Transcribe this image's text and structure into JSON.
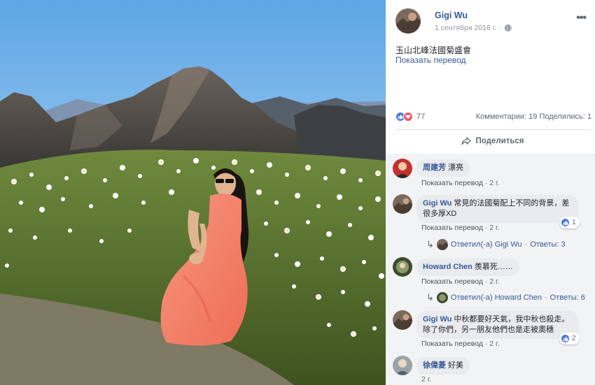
{
  "post": {
    "author": "Gigi Wu",
    "date": "1 сентября 2016 г.",
    "separator": "·",
    "text": "玉山北峰法國菊盛會",
    "translate": "Показать перевод",
    "reaction_count": "77",
    "counts": "Комментарии: 19  Поделились: 1",
    "share_label": "Поделиться",
    "colors": {
      "link": "#365899",
      "like": "#4a78e5",
      "love": "#f0536b"
    }
  },
  "comments": [
    {
      "author": "周建芳",
      "text": "漂亮",
      "translate": "Показать перевод",
      "sep": "·",
      "age": "2 г."
    },
    {
      "author": "Gigi Wu",
      "text": "常見的法國菊配上不同的背景，差",
      "text2": "很多厚XD",
      "translate": "Показать перевод",
      "sep": "·",
      "age": "2 г.",
      "likes": "1",
      "reply": {
        "label": "Ответил(-а) Gigi Wu",
        "sep": "·",
        "count": "Ответы: 3"
      }
    },
    {
      "author": "Howard Chen",
      "text": "羨慕死……",
      "translate": "Показать перевод",
      "sep": "·",
      "age": "2 г.",
      "reply": {
        "label": "Ответил(-а) Howard Chen",
        "sep": "·",
        "count": "Ответы: 6"
      }
    },
    {
      "author": "Gigi Wu",
      "text": "中秋都要好天氣，我中秋也殺走。",
      "text2": "除了你們，另一朋友他們也是走被奧穗",
      "translate": "Показать перевод",
      "sep": "·",
      "age": "2 г.",
      "likes": "2"
    },
    {
      "author": "徐偉菱",
      "text": "好美",
      "age": "2 г."
    }
  ]
}
